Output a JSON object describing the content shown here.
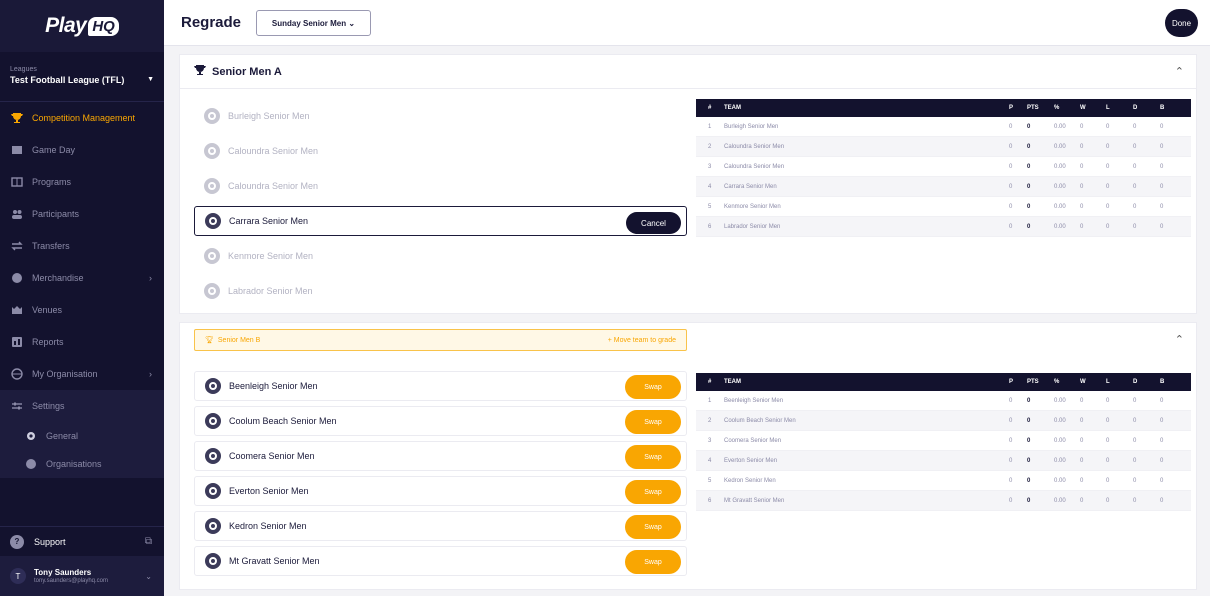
{
  "app": {
    "logo_text": "Play",
    "logo_badge": "HQ"
  },
  "sidebar": {
    "league_label": "Leagues",
    "league_name": "Test Football League (TFL)",
    "items": [
      {
        "label": "Competition Management",
        "icon": "trophy-icon",
        "active": true
      },
      {
        "label": "Game Day",
        "icon": "game-day-icon"
      },
      {
        "label": "Programs",
        "icon": "programs-icon"
      },
      {
        "label": "Participants",
        "icon": "participants-icon"
      },
      {
        "label": "Transfers",
        "icon": "transfers-icon"
      },
      {
        "label": "Merchandise",
        "icon": "merchandise-icon"
      },
      {
        "label": "Venues",
        "icon": "venues-icon"
      },
      {
        "label": "Reports",
        "icon": "reports-icon"
      },
      {
        "label": "My Organisation",
        "icon": "organisation-icon"
      },
      {
        "label": "Settings",
        "icon": "settings-icon"
      }
    ],
    "sub_items": [
      {
        "label": "General",
        "icon": "gear-icon"
      },
      {
        "label": "Organisations",
        "icon": "globe-icon"
      }
    ],
    "support_label": "Support",
    "user": {
      "initial": "T",
      "name": "Tony Saunders",
      "email": "tony.saunders@playhq.com"
    }
  },
  "header": {
    "title": "Regrade",
    "competition_select": "Sunday Senior Men ⌄",
    "done_label": "Done"
  },
  "grades": [
    {
      "name": "Senior Men A",
      "teams": [
        {
          "name": "Burleigh Senior Men",
          "state": "muted"
        },
        {
          "name": "Caloundra Senior Men",
          "state": "muted"
        },
        {
          "name": "Caloundra Senior Men",
          "state": "muted"
        },
        {
          "name": "Carrara Senior Men",
          "state": "selected",
          "action": "Cancel"
        },
        {
          "name": "Kenmore Senior Men",
          "state": "muted"
        },
        {
          "name": "Labrador Senior Men",
          "state": "muted"
        }
      ],
      "ladder_header": [
        "#",
        "TEAM",
        "P",
        "PTS",
        "%",
        "W",
        "L",
        "D",
        "B"
      ],
      "ladder": [
        [
          "1",
          "Burleigh Senior Men",
          "0",
          "0",
          "0.00",
          "0",
          "0",
          "0",
          "0"
        ],
        [
          "2",
          "Caloundra Senior Men",
          "0",
          "0",
          "0.00",
          "0",
          "0",
          "0",
          "0"
        ],
        [
          "3",
          "Caloundra Senior Men",
          "0",
          "0",
          "0.00",
          "0",
          "0",
          "0",
          "0"
        ],
        [
          "4",
          "Carrara Senior Men",
          "0",
          "0",
          "0.00",
          "0",
          "0",
          "0",
          "0"
        ],
        [
          "5",
          "Kenmore Senior Men",
          "0",
          "0",
          "0.00",
          "0",
          "0",
          "0",
          "0"
        ],
        [
          "6",
          "Labrador Senior Men",
          "0",
          "0",
          "0.00",
          "0",
          "0",
          "0",
          "0"
        ]
      ]
    },
    {
      "name": "Senior Men B",
      "move_label": "+ Move team to grade",
      "teams": [
        {
          "name": "Beenleigh Senior Men",
          "action": "Swap"
        },
        {
          "name": "Coolum Beach Senior Men",
          "action": "Swap"
        },
        {
          "name": "Coomera Senior Men",
          "action": "Swap"
        },
        {
          "name": "Everton Senior Men",
          "action": "Swap"
        },
        {
          "name": "Kedron Senior Men",
          "action": "Swap"
        },
        {
          "name": "Mt Gravatt Senior Men",
          "action": "Swap"
        }
      ],
      "ladder_header": [
        "#",
        "TEAM",
        "P",
        "PTS",
        "%",
        "W",
        "L",
        "D",
        "B"
      ],
      "ladder": [
        [
          "1",
          "Beenleigh Senior Men",
          "0",
          "0",
          "0.00",
          "0",
          "0",
          "0",
          "0"
        ],
        [
          "2",
          "Coolum Beach Senior Men",
          "0",
          "0",
          "0.00",
          "0",
          "0",
          "0",
          "0"
        ],
        [
          "3",
          "Coomera Senior Men",
          "0",
          "0",
          "0.00",
          "0",
          "0",
          "0",
          "0"
        ],
        [
          "4",
          "Everton Senior Men",
          "0",
          "0",
          "0.00",
          "0",
          "0",
          "0",
          "0"
        ],
        [
          "5",
          "Kedron Senior Men",
          "0",
          "0",
          "0.00",
          "0",
          "0",
          "0",
          "0"
        ],
        [
          "6",
          "Mt Gravatt Senior Men",
          "0",
          "0",
          "0.00",
          "0",
          "0",
          "0",
          "0"
        ]
      ]
    }
  ],
  "colors": {
    "sidebar": "#13122e",
    "accent": "#f9a602",
    "primary": "#13122e"
  }
}
